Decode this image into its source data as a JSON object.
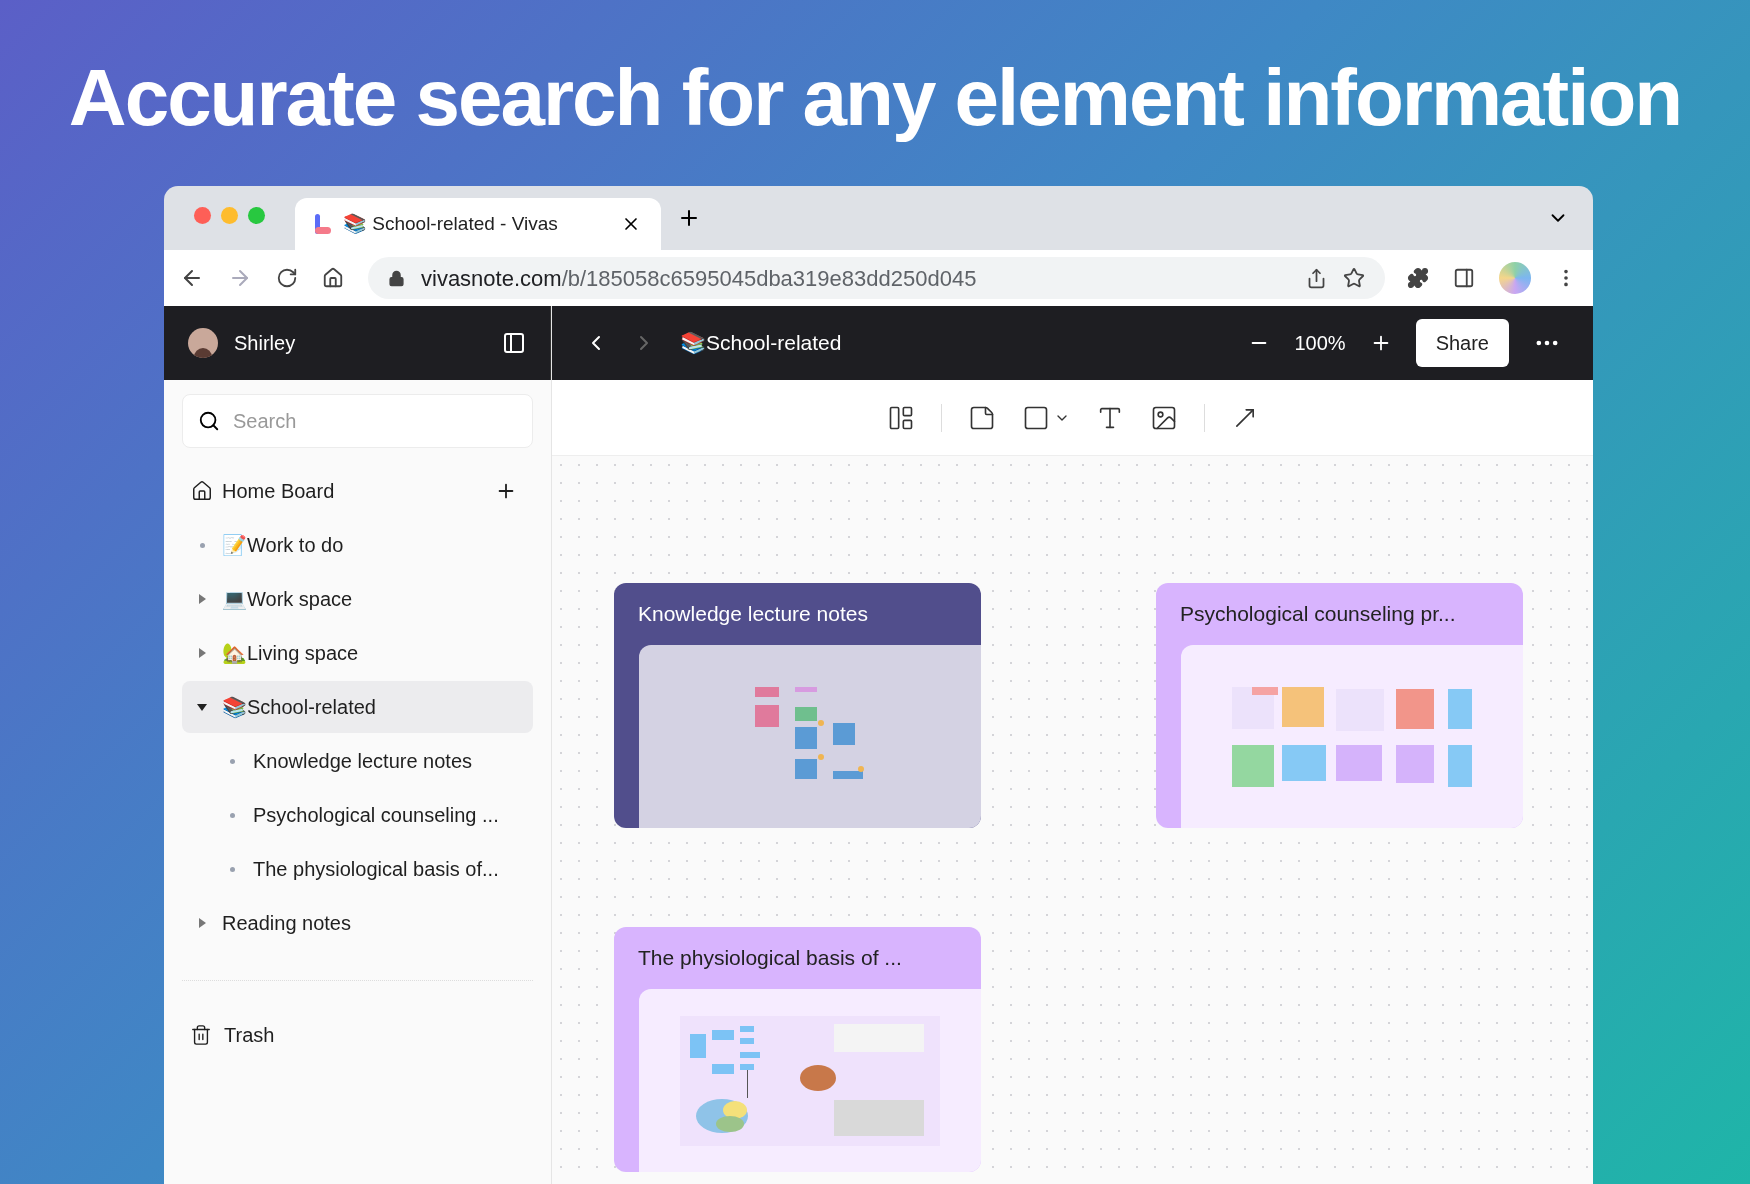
{
  "headline": "Accurate search for any element information",
  "browser": {
    "tab": {
      "title": "📚 School-related - Vivas"
    },
    "url": {
      "domain": "vivasnote.com",
      "path": "/b/185058c6595045dba319e83dd250d045"
    }
  },
  "app": {
    "user": "Shirley",
    "breadcrumb": "📚School-related",
    "zoom": "100%",
    "share": "Share"
  },
  "sidebar": {
    "search": {
      "placeholder": "Search"
    },
    "items": [
      {
        "kind": "home",
        "label": "Home Board",
        "selected": false
      },
      {
        "kind": "bullet",
        "label": "📝Work to do",
        "selected": false
      },
      {
        "kind": "folder",
        "label": "💻Work space",
        "expanded": false,
        "selected": false
      },
      {
        "kind": "folder",
        "label": "🏡Living space",
        "expanded": false,
        "selected": false
      },
      {
        "kind": "folder",
        "label": "📚School-related",
        "expanded": true,
        "selected": true,
        "children": [
          {
            "label": "Knowledge lecture notes"
          },
          {
            "label": "Psychological counseling ..."
          },
          {
            "label": "The physiological basis of..."
          }
        ]
      },
      {
        "kind": "folder",
        "label": "Reading notes",
        "expanded": false,
        "selected": false
      }
    ],
    "trash": "Trash"
  },
  "cards": [
    {
      "title": "Knowledge lecture notes",
      "color": "#514e8c",
      "kind": "flow"
    },
    {
      "title": "Psychological counseling pr...",
      "color": "#d8b4fe",
      "kind": "notes"
    },
    {
      "title": "The physiological basis of ...",
      "color": "#d8b4fe",
      "kind": "brain"
    }
  ]
}
